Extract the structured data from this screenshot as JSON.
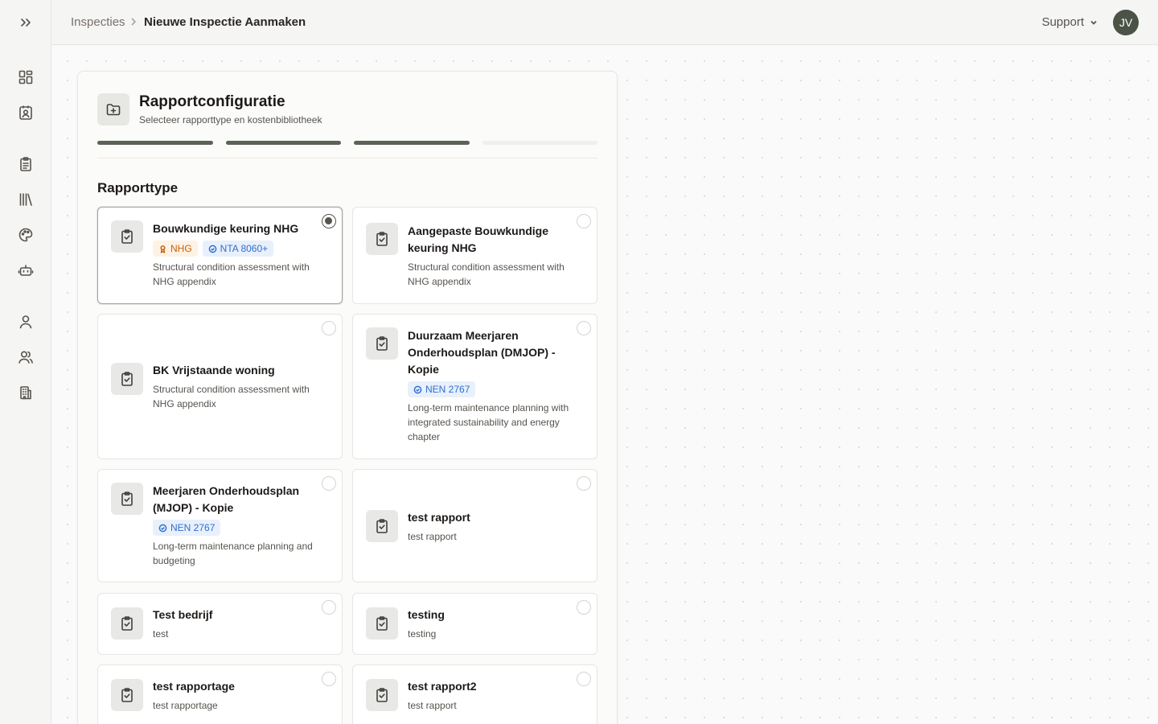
{
  "breadcrumb": {
    "parent": "Inspecties",
    "current": "Nieuwe Inspectie Aanmaken"
  },
  "header": {
    "support_label": "Support",
    "avatar_initials": "JV"
  },
  "sidebar": {
    "icons": [
      "expand-icon",
      "dashboard-icon",
      "contact-card-icon",
      "clipboard-list-icon",
      "library-icon",
      "palette-icon",
      "robot-icon",
      "user-icon",
      "users-icon",
      "building-icon"
    ]
  },
  "panel": {
    "title": "Rapportconfiguratie",
    "subtitle": "Selecteer rapporttype en kostenbibliotheek",
    "steps_total": 4,
    "steps_completed": 3,
    "section_title": "Rapporttype"
  },
  "report_types": [
    {
      "title": "Bouwkundige keuring NHG",
      "badges": [
        {
          "label": "NHG",
          "color": "orange"
        },
        {
          "label": "NTA 8060+",
          "color": "blue"
        }
      ],
      "description": "Structural condition assessment with NHG appendix",
      "selected": true
    },
    {
      "title": "Aangepaste Bouwkundige keuring NHG",
      "badges": [],
      "description": "Structural condition assessment with NHG appendix",
      "selected": false
    },
    {
      "title": "BK Vrijstaande woning",
      "badges": [],
      "description": "Structural condition assessment with NHG appendix",
      "selected": false
    },
    {
      "title": "Duurzaam Meerjaren Onderhoudsplan (DMJOP) - Kopie",
      "badges": [
        {
          "label": "NEN 2767",
          "color": "blue"
        }
      ],
      "description": "Long-term maintenance planning with integrated sustainability and energy chapter",
      "selected": false
    },
    {
      "title": "Meerjaren Onderhoudsplan (MJOP) - Kopie",
      "badges": [
        {
          "label": "NEN 2767",
          "color": "blue"
        }
      ],
      "description": "Long-term maintenance planning and budgeting",
      "selected": false
    },
    {
      "title": "test rapport",
      "badges": [],
      "description": "test rapport",
      "selected": false
    },
    {
      "title": "Test bedrijf",
      "badges": [],
      "description": "test",
      "selected": false
    },
    {
      "title": "testing",
      "badges": [],
      "description": "testing",
      "selected": false
    },
    {
      "title": "test rapportage",
      "badges": [],
      "description": "test rapportage",
      "selected": false
    },
    {
      "title": "test rapport2",
      "badges": [],
      "description": "test rapport",
      "selected": false
    }
  ],
  "colors": {
    "accent": "#5a6356",
    "avatar_bg": "#4a5346",
    "badge_orange": "#c2630a",
    "badge_blue": "#2f6fce"
  }
}
